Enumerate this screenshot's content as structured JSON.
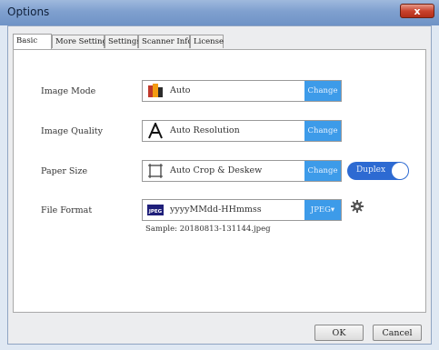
{
  "window": {
    "title": "Options",
    "close_glyph": "x"
  },
  "tabs": [
    {
      "label": "Basic",
      "active": true
    },
    {
      "label": "More Settings",
      "active": false
    },
    {
      "label": "Settings",
      "active": false
    },
    {
      "label": "Scanner Info.",
      "active": false
    },
    {
      "label": "License",
      "active": false
    }
  ],
  "rows": {
    "image_mode": {
      "label": "Image Mode",
      "value": "Auto",
      "icon": "color-mode-icon",
      "button": "Change"
    },
    "image_quality": {
      "label": "Image Quality",
      "value": "Auto Resolution",
      "icon": "letter-a-icon",
      "button": "Change"
    },
    "paper_size": {
      "label": "Paper Size",
      "value": "Auto Crop & Deskew",
      "icon": "crop-frame-icon",
      "button": "Change"
    },
    "file_format": {
      "label": "File Format",
      "value": "yyyyMMdd-HHmmss",
      "icon": "jpeg-icon",
      "icon_text": "JPEG",
      "button": "JPEG"
    }
  },
  "duplex": {
    "label": "Duplex",
    "on": true
  },
  "sample": "Sample: 20180813-131144.jpeg",
  "buttons": {
    "ok": "OK",
    "cancel": "Cancel"
  },
  "colors": {
    "accent": "#3d9be9",
    "toggle": "#2d6ad2",
    "close": "#c9432e"
  }
}
